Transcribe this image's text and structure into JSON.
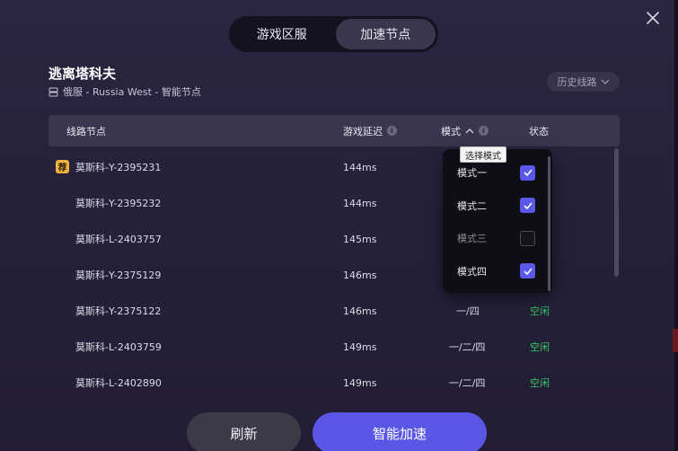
{
  "tabs": [
    {
      "label": "游戏区服",
      "active": false
    },
    {
      "label": "加速节点",
      "active": true
    }
  ],
  "game": {
    "title": "逃离塔科夫",
    "server": "俄服 - Russia West - 智能节点"
  },
  "history_button": {
    "label": "历史线路"
  },
  "table": {
    "headers": {
      "node": "线路节点",
      "latency": "游戏延迟",
      "mode": "模式",
      "status": "状态"
    },
    "rows": [
      {
        "recommend": "荐",
        "name": "莫斯科-Y-2395231",
        "latency": "144ms",
        "mode": "",
        "status": ""
      },
      {
        "name": "莫斯科-Y-2395232",
        "latency": "144ms",
        "mode": "",
        "status": ""
      },
      {
        "name": "莫斯科-L-2403757",
        "latency": "145ms",
        "mode": "",
        "status": ""
      },
      {
        "name": "莫斯科-Y-2375129",
        "latency": "146ms",
        "mode": "",
        "status": ""
      },
      {
        "name": "莫斯科-Y-2375122",
        "latency": "146ms",
        "mode": "一/四",
        "status": "空闲"
      },
      {
        "name": "莫斯科-L-2403759",
        "latency": "149ms",
        "mode": "一/二/四",
        "status": "空闲"
      },
      {
        "name": "莫斯科-L-2402890",
        "latency": "149ms",
        "mode": "一/二/四",
        "status": "空闲"
      }
    ]
  },
  "mode_dropdown": {
    "tooltip": "选择模式",
    "options": [
      {
        "label": "模式一",
        "checked": true
      },
      {
        "label": "模式二",
        "checked": true
      },
      {
        "label": "模式三",
        "checked": false
      },
      {
        "label": "模式四",
        "checked": true
      }
    ]
  },
  "buttons": {
    "refresh": "刷新",
    "smart_accelerate": "智能加速"
  },
  "colors": {
    "accent": "#5b57e6",
    "status_idle": "#39c76a",
    "recommend_badge": "#f2b43c"
  },
  "icons": {
    "close": "close-icon",
    "server": "server-icon",
    "history_chevron": "chevron-down-icon",
    "info": "info-icon",
    "mode_sort": "chevron-up-icon",
    "check": "check-icon"
  }
}
